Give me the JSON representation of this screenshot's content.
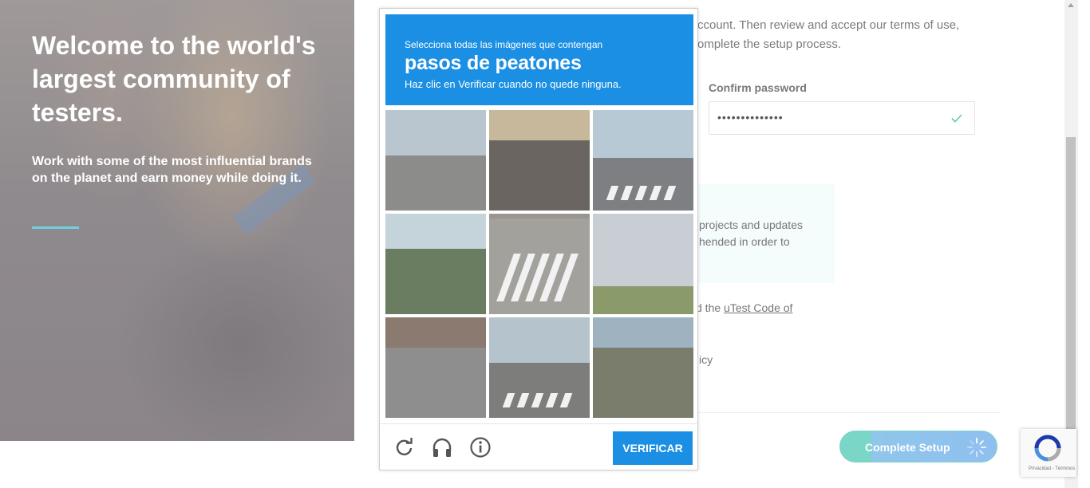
{
  "hero": {
    "title": "Welcome to the world's largest community of testers.",
    "subtitle": "Work with some of the most influential brands on the planet and earn money while doing it."
  },
  "form": {
    "intro": "ccount. Then review and accept our terms of use, omplete the setup process.",
    "confirm_password_label": "Confirm password",
    "confirm_password_value": "••••••••••••••",
    "info_text": "projects and updates hended in order to",
    "code_prefix": "d the ",
    "code_link": "uTest Code of",
    "policy_fragment": "icy",
    "complete_button": "Complete Setup"
  },
  "captcha": {
    "instruction": "Selecciona todas las imágenes que contengan",
    "target": "pasos de peatones",
    "hint": "Haz clic en Verificar cuando no quede ninguna.",
    "verify_button": "VERIFICAR",
    "icons": [
      "reload-icon",
      "audio-headphones-icon",
      "info-icon"
    ],
    "tiles": [
      {
        "sky": "#b9c6cf",
        "ground": "#8c8c8a",
        "horizon": 0.45
      },
      {
        "sky": "#c7b89b",
        "ground": "#6a6560",
        "horizon": 0.3
      },
      {
        "sky": "#b8c9d6",
        "ground": "#7d7f82",
        "horizon": 0.48
      },
      {
        "sky": "#c5d3da",
        "ground": "#6b7d60",
        "horizon": 0.35
      },
      {
        "sky": "#9a968f",
        "ground": "#a3a19c",
        "horizon": 0.05
      },
      {
        "sky": "#c9ced4",
        "ground": "#8a9a6b",
        "horizon": 0.72
      },
      {
        "sky": "#8a7a70",
        "ground": "#8e8e8e",
        "horizon": 0.3
      },
      {
        "sky": "#b5c4cc",
        "ground": "#7d7d7b",
        "horizon": 0.45
      },
      {
        "sky": "#9fb2c0",
        "ground": "#7a7d6c",
        "horizon": 0.3
      }
    ]
  },
  "badge": {
    "text": "Privacidad - Términos"
  },
  "colors": {
    "captcha_blue": "#1a8fe3",
    "accent_cyan": "#6fd0e3",
    "check_green": "#5fc9a8"
  }
}
